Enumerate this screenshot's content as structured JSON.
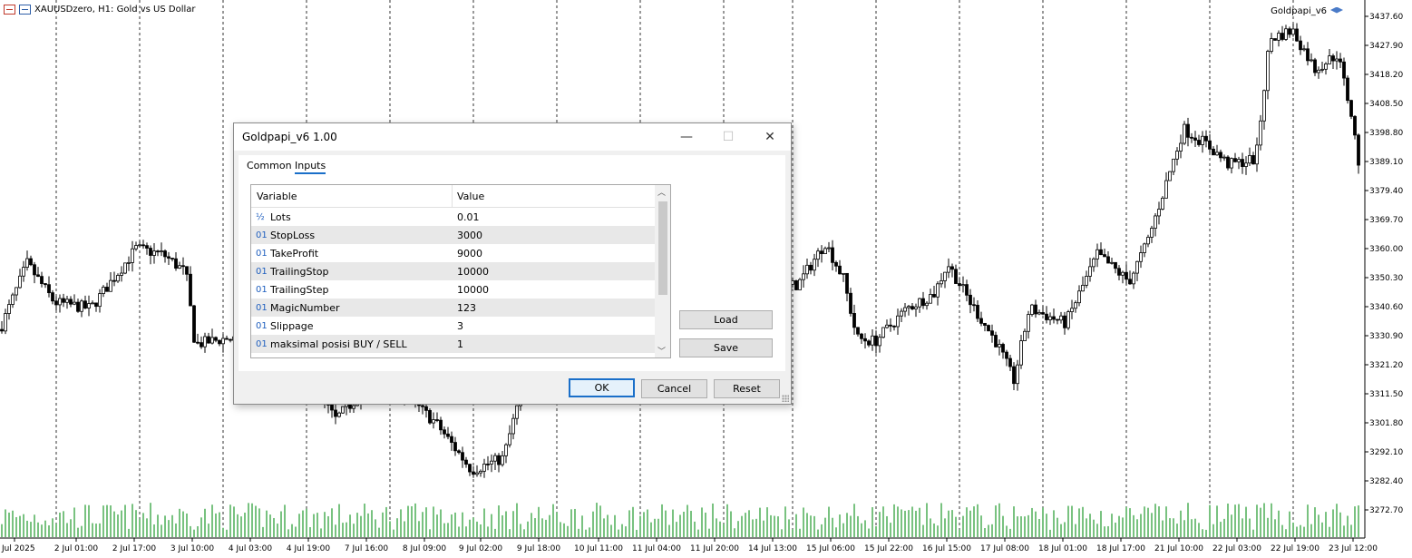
{
  "chart": {
    "symbol": "XAUUSDzero, H1:  Gold vs US Dollar",
    "ea_name": "Goldpapi_v6",
    "price_labels": [
      "3437.60",
      "3427.90",
      "3418.20",
      "3408.50",
      "3398.80",
      "3389.10",
      "3379.40",
      "3369.70",
      "3360.00",
      "3350.30",
      "3340.60",
      "3330.90",
      "3321.20",
      "3311.50",
      "3301.80",
      "3292.10",
      "3282.40",
      "3272.70"
    ],
    "time_labels": [
      "1 Jul 2025",
      "2 Jul 01:00",
      "2 Jul 17:00",
      "3 Jul 10:00",
      "4 Jul 03:00",
      "4 Jul 19:00",
      "7 Jul 16:00",
      "8 Jul 09:00",
      "9 Jul 02:00",
      "9 Jul 18:00",
      "10 Jul 11:00",
      "11 Jul 04:00",
      "11 Jul 20:00",
      "14 Jul 13:00",
      "15 Jul 06:00",
      "15 Jul 22:00",
      "16 Jul 15:00",
      "17 Jul 08:00",
      "18 Jul 01:00",
      "18 Jul 17:00",
      "21 Jul 10:00",
      "22 Jul 03:00",
      "22 Jul 19:00",
      "23 Jul 12:00"
    ],
    "colors": {
      "volume": "#1f9a2c",
      "candle": "#000000"
    }
  },
  "dialog": {
    "title": "Goldpapi_v6 1.00",
    "controls": {
      "minimize": "—",
      "maximize": "☐",
      "close": "✕"
    },
    "tabs": [
      "Common",
      "Inputs"
    ],
    "active_tab": "Inputs",
    "grid": {
      "col_variable": "Variable",
      "col_value": "Value",
      "rows": [
        {
          "type": "½",
          "name": "Lots",
          "value": "0.01"
        },
        {
          "type": "01",
          "name": "StopLoss",
          "value": "3000"
        },
        {
          "type": "01",
          "name": "TakeProfit",
          "value": "9000"
        },
        {
          "type": "01",
          "name": "TrailingStop",
          "value": "10000"
        },
        {
          "type": "01",
          "name": "TrailingStep",
          "value": "10000"
        },
        {
          "type": "01",
          "name": "MagicNumber",
          "value": "123"
        },
        {
          "type": "01",
          "name": "Slippage",
          "value": "3"
        },
        {
          "type": "01",
          "name": "maksimal posisi BUY / SELL",
          "value": "1"
        }
      ]
    },
    "buttons": {
      "load": "Load",
      "save": "Save",
      "ok": "OK",
      "cancel": "Cancel",
      "reset": "Reset"
    }
  }
}
